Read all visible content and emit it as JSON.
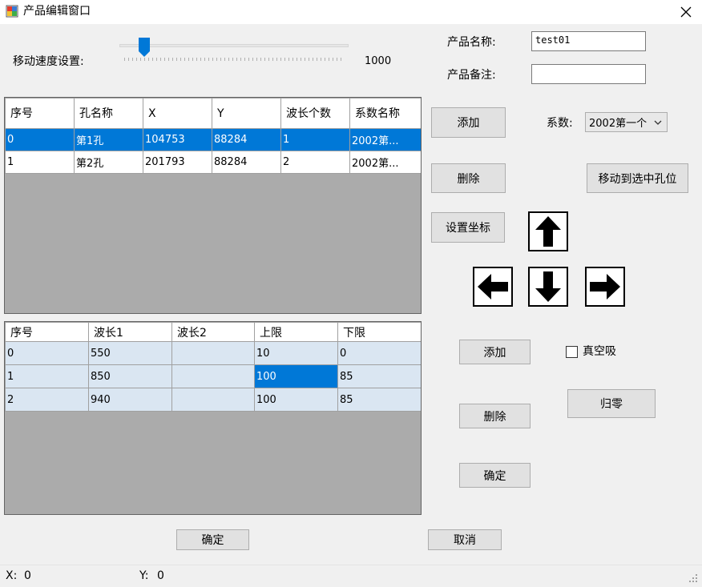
{
  "window": {
    "title": "产品编辑窗口"
  },
  "speed": {
    "label": "移动速度设置:",
    "value": "1000",
    "fraction": 0.09
  },
  "product": {
    "name_label": "产品名称:",
    "name_value": "test01",
    "remark_label": "产品备注:",
    "remark_value": ""
  },
  "holes": {
    "columns": [
      "序号",
      "孔名称",
      "X",
      "Y",
      "波长个数",
      "系数名称"
    ],
    "rows": [
      [
        "0",
        "第1孔",
        "104753",
        "88284",
        "1",
        "2002第..."
      ],
      [
        "1",
        "第2孔",
        "201793",
        "88284",
        "2",
        "2002第..."
      ]
    ]
  },
  "wavelengths": {
    "columns": [
      "序号",
      "波长1",
      "波长2",
      "上限",
      "下限"
    ],
    "rows": [
      [
        "0",
        "550",
        "",
        "10",
        "0"
      ],
      [
        "1",
        "850",
        "",
        "100",
        "85"
      ],
      [
        "2",
        "940",
        "",
        "100",
        "85"
      ]
    ]
  },
  "controls": {
    "add_hole": "添加",
    "delete_hole": "删除",
    "set_coord": "设置坐标",
    "coef_label": "系数:",
    "coef_value": "2002第一个",
    "move_to_hole": "移动到选中孔位",
    "add_wave": "添加",
    "delete_wave": "删除",
    "confirm_wave": "确定",
    "vacuum_label": "真空吸",
    "zero": "归零",
    "ok": "确定",
    "cancel": "取消"
  },
  "status": {
    "x_label": "X:",
    "x_value": "0",
    "y_label": "Y:",
    "y_value": "0"
  }
}
